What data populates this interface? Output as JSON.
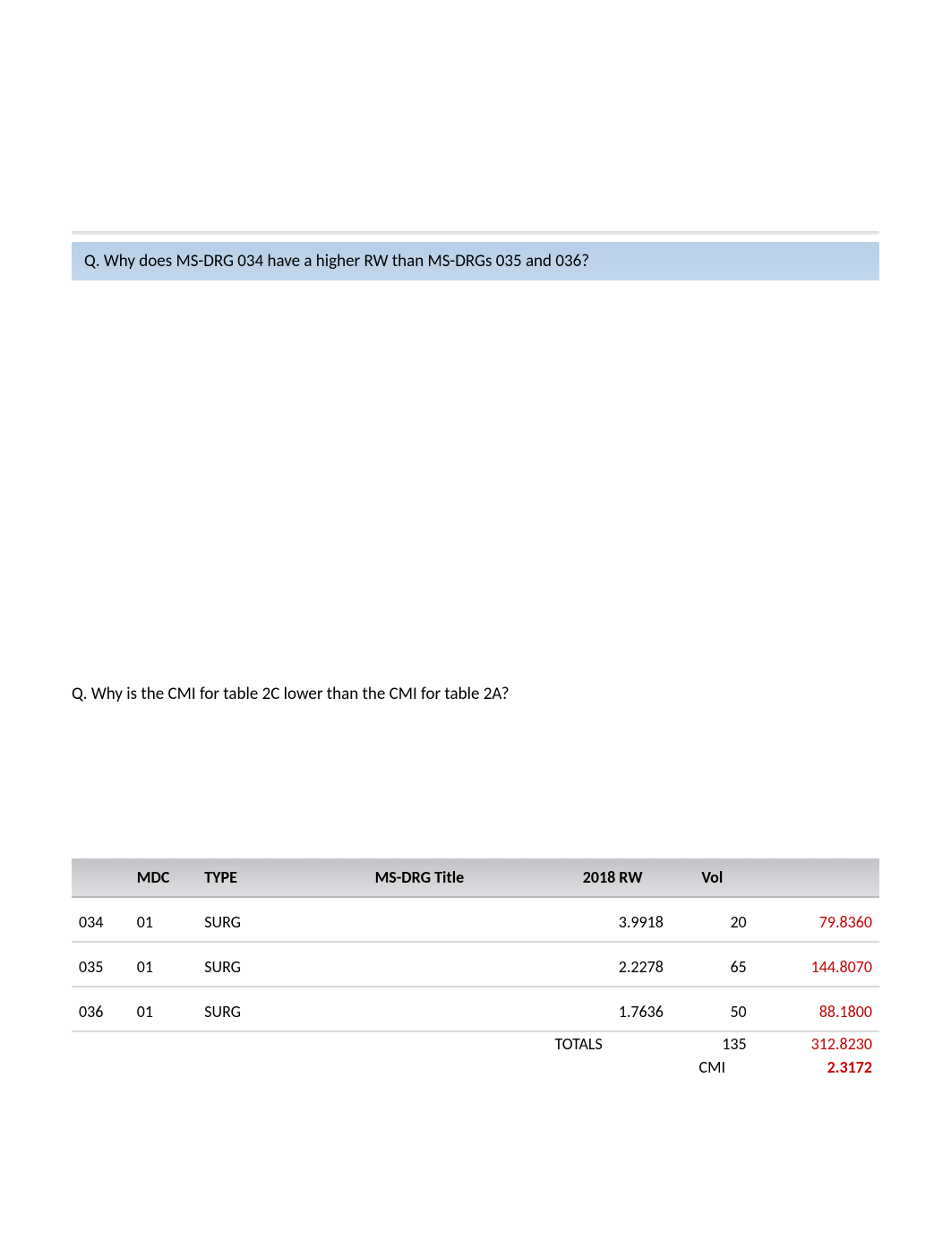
{
  "question1": "Q. Why does MS-DRG 034 have a higher RW than MS-DRGs 035 and 036?",
  "question2": "Q. Why is the CMI for table 2C lower than the CMI for table 2A?",
  "table": {
    "headers": {
      "col0": "",
      "mdc": "MDC",
      "type": "TYPE",
      "title": "MS-DRG Title",
      "rw": "2018 RW",
      "vol": "Vol",
      "prod": ""
    },
    "rows": [
      {
        "drg": "034",
        "mdc": "01",
        "type": "SURG",
        "title": "",
        "rw": "3.9918",
        "vol": "20",
        "prod": "79.8360"
      },
      {
        "drg": "035",
        "mdc": "01",
        "type": "SURG",
        "title": "",
        "rw": "2.2278",
        "vol": "65",
        "prod": "144.8070"
      },
      {
        "drg": "036",
        "mdc": "01",
        "type": "SURG",
        "title": "",
        "rw": "1.7636",
        "vol": "50",
        "prod": "88.1800"
      }
    ],
    "totals": {
      "label": "TOTALS",
      "vol": "135",
      "prod": "312.8230"
    },
    "cmi": {
      "label": "CMI",
      "value": "2.3172"
    }
  }
}
